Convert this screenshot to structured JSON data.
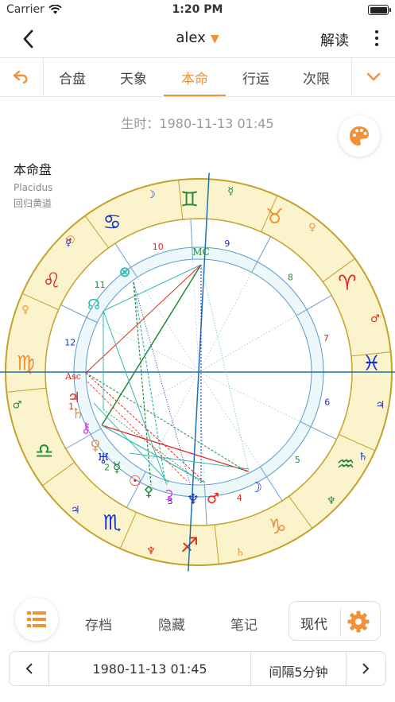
{
  "status": {
    "carrier": "Carrier",
    "time": "1:20 PM",
    "battery_level": 1.0
  },
  "nav": {
    "title": "alex",
    "read_label": "解读"
  },
  "tabs": [
    {
      "label": "合盘",
      "active": false
    },
    {
      "label": "天象",
      "active": false
    },
    {
      "label": "本命",
      "active": true
    },
    {
      "label": "行运",
      "active": false
    },
    {
      "label": "次限",
      "active": false
    }
  ],
  "birth_time": "生时：1980-11-13 01:45",
  "chart": {
    "title": "本命盘",
    "house_system": "Placidus",
    "zodiac": "回归黄道",
    "mc_label": "MC",
    "asc_label": "Asc",
    "house_numbers": [
      "1",
      "2",
      "3",
      "4",
      "5",
      "6",
      "7",
      "8",
      "9",
      "10",
      "11",
      "12"
    ],
    "sign_glyphs": [
      "♊",
      "♉",
      "♈",
      "♓",
      "♒",
      "♑",
      "♐",
      "♏",
      "♎",
      "♍",
      "♌",
      "♋"
    ],
    "ruler_glyphs": [
      "☿",
      "♀",
      "♂",
      "♃",
      "♄",
      "♆",
      "♄",
      "♆",
      "♃",
      "♂",
      "♀",
      "☿",
      "☉",
      "☽"
    ],
    "planet_glyphs": [
      "⊗",
      "☊",
      "♃",
      "♄",
      "⚷",
      "♀",
      "♅",
      "☿",
      "☉",
      "⚴",
      "⚳",
      "♆",
      "♂",
      "☽"
    ],
    "colors": {
      "ring": "#fbf3cc",
      "ring_border": "#c4a22a",
      "inner": "#ecf8fa",
      "axis": "#1a6fb5",
      "red": "#e1261c",
      "blue": "#1730c8",
      "green": "#1f8a3a",
      "teal": "#2fb9b0",
      "magenta": "#e040e0",
      "orange": "#f0913a"
    }
  },
  "toolbar": {
    "archive": "存档",
    "hide": "隐藏",
    "notes": "笔记",
    "mode": "现代"
  },
  "stepper": {
    "date": "1980-11-13 01:45",
    "interval": "间隔5分钟"
  }
}
